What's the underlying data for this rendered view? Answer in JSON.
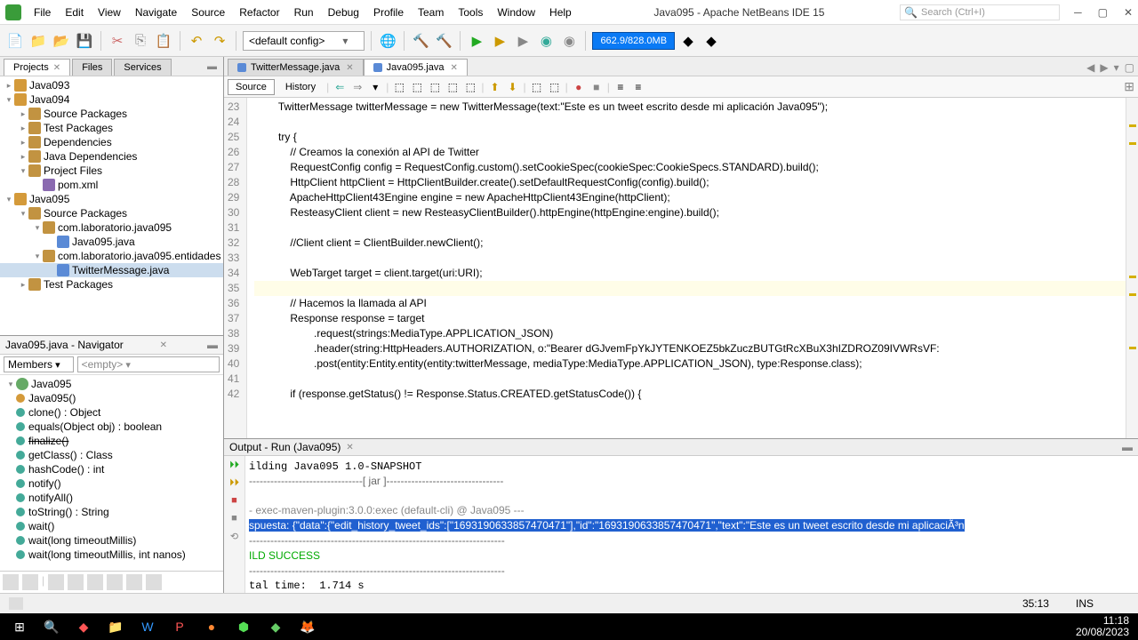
{
  "title": "Java095 - Apache NetBeans IDE 15",
  "menubar": [
    "File",
    "Edit",
    "View",
    "Navigate",
    "Source",
    "Refactor",
    "Run",
    "Debug",
    "Profile",
    "Team",
    "Tools",
    "Window",
    "Help"
  ],
  "search_placeholder": "Search (Ctrl+I)",
  "config_select": "<default config>",
  "mem_gauge": "662.9/828.0MB",
  "left_tabs": [
    "Projects",
    "Files",
    "Services"
  ],
  "tree": [
    {
      "l": 0,
      "t": "▸",
      "i": "prj",
      "n": "Java093"
    },
    {
      "l": 0,
      "t": "▾",
      "i": "prj",
      "n": "Java094"
    },
    {
      "l": 1,
      "t": "▸",
      "i": "pkg",
      "n": "Source Packages"
    },
    {
      "l": 1,
      "t": "▸",
      "i": "pkg",
      "n": "Test Packages"
    },
    {
      "l": 1,
      "t": "▸",
      "i": "pkg",
      "n": "Dependencies"
    },
    {
      "l": 1,
      "t": "▸",
      "i": "pkg",
      "n": "Java Dependencies"
    },
    {
      "l": 1,
      "t": "▾",
      "i": "pkg",
      "n": "Project Files"
    },
    {
      "l": 2,
      "t": "",
      "i": "xml",
      "n": "pom.xml"
    },
    {
      "l": 0,
      "t": "▾",
      "i": "prj",
      "n": "Java095"
    },
    {
      "l": 1,
      "t": "▾",
      "i": "pkg",
      "n": "Source Packages"
    },
    {
      "l": 2,
      "t": "▾",
      "i": "pkg",
      "n": "com.laboratorio.java095"
    },
    {
      "l": 3,
      "t": "",
      "i": "java",
      "n": "Java095.java"
    },
    {
      "l": 2,
      "t": "▾",
      "i": "pkg",
      "n": "com.laboratorio.java095.entidades"
    },
    {
      "l": 3,
      "t": "",
      "i": "java",
      "n": "TwitterMessage.java",
      "sel": true
    },
    {
      "l": 1,
      "t": "▸",
      "i": "pkg",
      "n": "Test Packages"
    }
  ],
  "nav_title": "Java095.java - Navigator",
  "members_label": "Members",
  "members_filter": "<empty>",
  "nav_items": [
    {
      "k": "class",
      "txt": "Java095",
      "pad": 2
    },
    {
      "k": "ctor",
      "txt": "Java095()",
      "c": "#d49a3a"
    },
    {
      "k": "m",
      "txt": "clone() : Object",
      "c": "#4a9"
    },
    {
      "k": "m",
      "txt": "equals(Object obj) : boolean",
      "c": "#4a9"
    },
    {
      "k": "m",
      "txt": "finalize()",
      "c": "#4a9",
      "strike": true
    },
    {
      "k": "m",
      "txt": "getClass() : Class<?>",
      "c": "#4a9"
    },
    {
      "k": "m",
      "txt": "hashCode() : int",
      "c": "#4a9"
    },
    {
      "k": "m",
      "txt": "notify()",
      "c": "#4a9"
    },
    {
      "k": "m",
      "txt": "notifyAll()",
      "c": "#4a9"
    },
    {
      "k": "m",
      "txt": "toString() : String",
      "c": "#4a9"
    },
    {
      "k": "m",
      "txt": "wait()",
      "c": "#4a9"
    },
    {
      "k": "m",
      "txt": "wait(long timeoutMillis)",
      "c": "#4a9"
    },
    {
      "k": "m",
      "txt": "wait(long timeoutMillis, int nanos)",
      "c": "#4a9"
    }
  ],
  "file_tabs": [
    {
      "name": "TwitterMessage.java",
      "active": false
    },
    {
      "name": "Java095.java",
      "active": true
    }
  ],
  "editor_tb_src": "Source",
  "editor_tb_hist": "History",
  "code": {
    "start": 23,
    "lines": [
      "        TwitterMessage twitterMessage = <kw>new</kw> TwitterMessage(<ital>text:</ital><str>\"Este es un tweet escrito desde mi aplicación Java095\"</str>);",
      "",
      "        <kw>try</kw> {",
      "            <cmt>// Creamos la conexión al API de Twitter</cmt>",
      "            <typ>RequestConfig</typ> config = <typ>RequestConfig</typ>.<ital>custom</ital>().setCookieSpec(<ital>cookieSpec:</ital>CookieSpecs.<cst>STANDARD</cst>).build();",
      "            HttpClient httpClient = HttpClientBuilder.create().setDefaultRequestConfig(config).build();",
      "            ApacheHttpClient43Engine engine = <kw>new</kw> ApacheHttpClient43Engine(httpClient);",
      "            ResteasyClient client = <kw>new</kw> ResteasyClientBuilder().httpEngine(<ital>httpEngine:</ital>engine).build();",
      "",
      "            <cmt>//Client client = ClientBuilder.newClient();</cmt>",
      "",
      "            WebTarget target = client.target(<ital>uri:</ital>URI);",
      "",
      "            <cmt>// Hacemos la llamada al API</cmt>",
      "            Response response = target",
      "                    .request(<ital>strings:</ital>MediaType.<cst>APPLICATION_JSON</cst>)",
      "                    .header(<ital>string:</ital>HttpHeaders.<cst>AUTHORIZATION</cst>, <ital>o:</ital><str>\"Bearer dGJvemFpYkJYTENKOEZ5bkZuczBUTGtRcXBuX3hIZDROZ09IVWRsVF:</str>",
      "                    .post(<ital>entity:</ital>Entity.entity(<ital>entity:</ital>twitterMessage, <ital>mediaType:</ital>MediaType.<cst>APPLICATION_JSON</cst>), <ital>type:</ital>Response.<kw>class</kw>);",
      "",
      "            <kw>if</kw> (response.getStatus() != Response.Status.<cst>CREATED</cst>.getStatusCode()) {"
    ],
    "hl_index": 12
  },
  "output_title": "Output - Run (Java095)",
  "output_lines": [
    "ilding Java095 1.0-SNAPSHOT",
    "--------------------------------[ jar ]---------------------------------",
    "",
    "- exec-maven-plugin:3.0.0:exec (default-cli) @ Java095 ---",
    "spuesta: {\"data\":{\"edit_history_tweet_ids\":[\"1693190633857470471\"],\"id\":\"1693190633857470471\",\"text\":\"Este es un tweet escrito desde mi aplicaciÃ³n",
    "------------------------------------------------------------------------",
    "ILD SUCCESS",
    "------------------------------------------------------------------------",
    "tal time:  1.714 s"
  ],
  "output_sel_index": 4,
  "status": {
    "pos": "35:13",
    "ins": "INS"
  },
  "tray": {
    "time": "11:18",
    "date": "20/08/2023"
  }
}
